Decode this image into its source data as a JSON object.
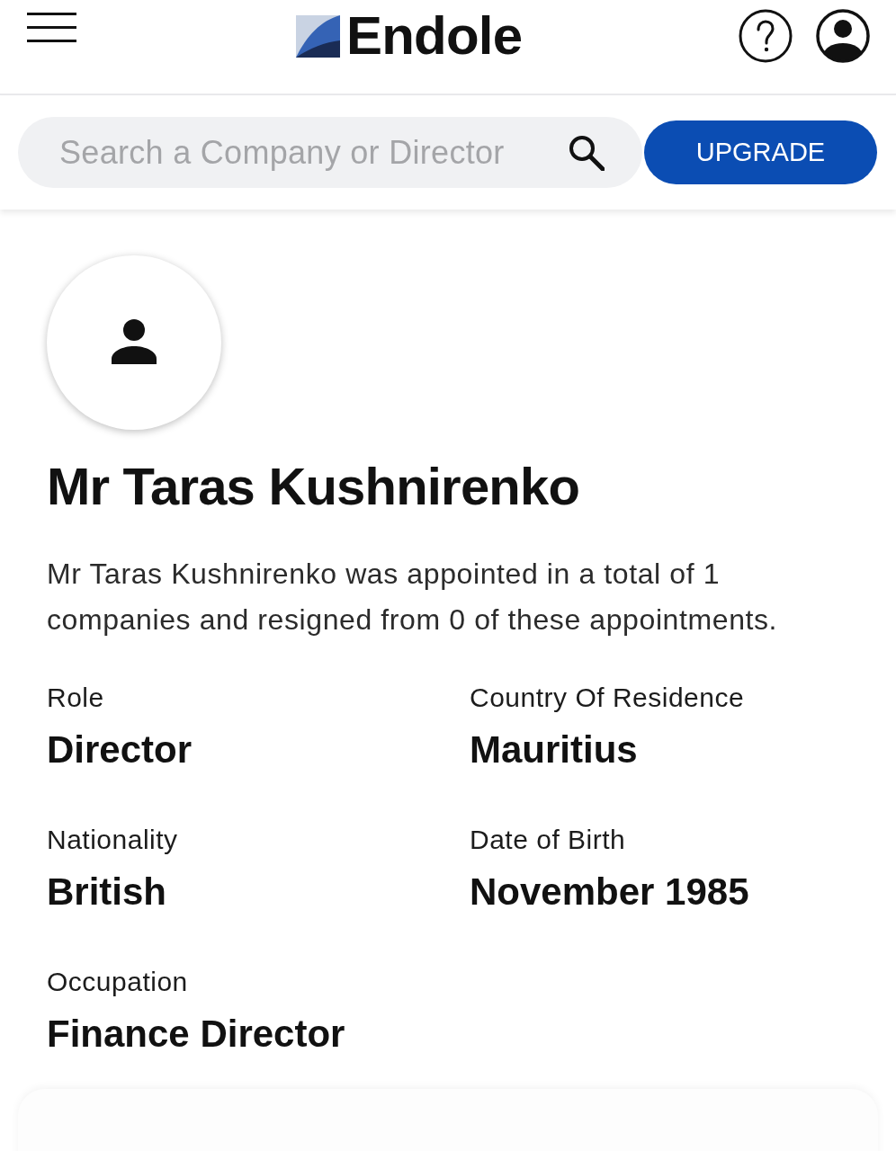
{
  "header": {
    "logo": "Endole"
  },
  "search": {
    "placeholder": "Search a Company or Director",
    "button": "UPGRADE"
  },
  "profile": {
    "name": "Mr Taras Kushnirenko",
    "summary": "Mr Taras Kushnirenko was appointed in a total of 1 companies and resigned from 0 of these appointments.",
    "fields": [
      {
        "label": "Role",
        "value": "Director"
      },
      {
        "label": "Country Of Residence",
        "value": "Mauritius"
      },
      {
        "label": "Nationality",
        "value": "British"
      },
      {
        "label": "Date of Birth",
        "value": "November 1985"
      },
      {
        "label": "Occupation",
        "value": "Finance Director"
      }
    ]
  }
}
